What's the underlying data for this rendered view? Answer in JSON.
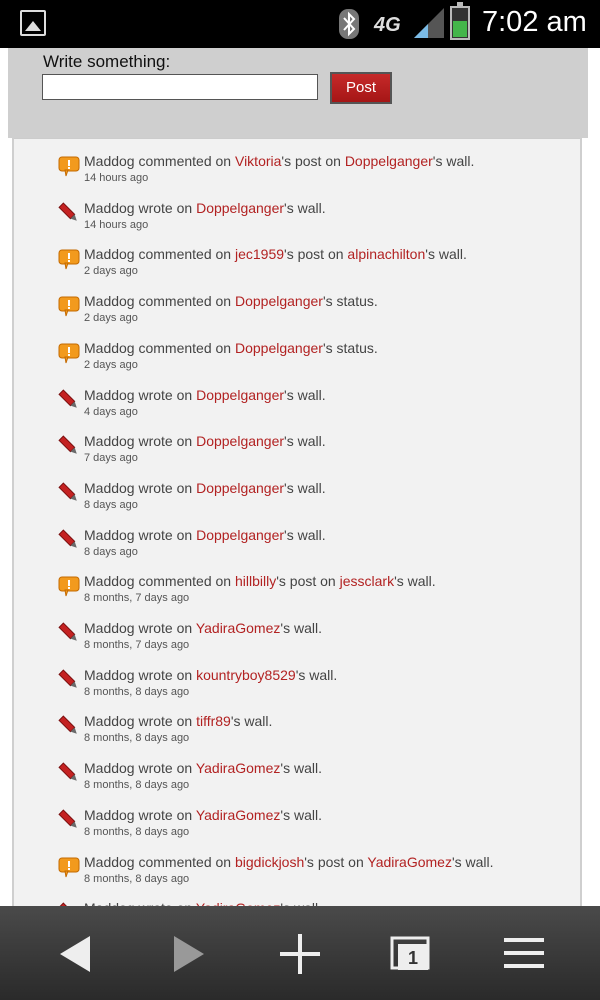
{
  "status_bar": {
    "network": "4G",
    "time": "7:02 am"
  },
  "composer": {
    "label": "Write something:",
    "input_value": "",
    "post_label": "Post"
  },
  "feed": [
    {
      "type": "comment",
      "actor": "Maddog",
      "verb": "commented on",
      "target": "Viktoria",
      "mid": "'s post on",
      "target2": "Doppelganger",
      "tail": "'s wall.",
      "time": "14 hours ago"
    },
    {
      "type": "write",
      "actor": "Maddog",
      "verb": "wrote on",
      "target": "Doppelganger",
      "mid": "",
      "target2": "",
      "tail": "'s wall.",
      "time": "14 hours ago"
    },
    {
      "type": "comment",
      "actor": "Maddog",
      "verb": "commented on",
      "target": "jec1959",
      "mid": "'s post on",
      "target2": "alpinachilton",
      "tail": "'s wall.",
      "time": "2 days ago"
    },
    {
      "type": "comment",
      "actor": "Maddog",
      "verb": "commented on",
      "target": "Doppelganger",
      "mid": "",
      "target2": "",
      "tail": "'s status.",
      "time": "2 days ago"
    },
    {
      "type": "comment",
      "actor": "Maddog",
      "verb": "commented on",
      "target": "Doppelganger",
      "mid": "",
      "target2": "",
      "tail": "'s status.",
      "time": "2 days ago"
    },
    {
      "type": "write",
      "actor": "Maddog",
      "verb": "wrote on",
      "target": "Doppelganger",
      "mid": "",
      "target2": "",
      "tail": "'s wall.",
      "time": "4 days ago"
    },
    {
      "type": "write",
      "actor": "Maddog",
      "verb": "wrote on",
      "target": "Doppelganger",
      "mid": "",
      "target2": "",
      "tail": "'s wall.",
      "time": "7 days ago"
    },
    {
      "type": "write",
      "actor": "Maddog",
      "verb": "wrote on",
      "target": "Doppelganger",
      "mid": "",
      "target2": "",
      "tail": "'s wall.",
      "time": "8 days ago"
    },
    {
      "type": "write",
      "actor": "Maddog",
      "verb": "wrote on",
      "target": "Doppelganger",
      "mid": "",
      "target2": "",
      "tail": "'s wall.",
      "time": "8 days ago"
    },
    {
      "type": "comment",
      "actor": "Maddog",
      "verb": "commented on",
      "target": "hillbilly",
      "mid": "'s post on",
      "target2": "jessclark",
      "tail": "'s wall.",
      "time": "8 months, 7 days ago"
    },
    {
      "type": "write",
      "actor": "Maddog",
      "verb": "wrote on",
      "target": "YadiraGomez",
      "mid": "",
      "target2": "",
      "tail": "'s wall.",
      "time": "8 months, 7 days ago"
    },
    {
      "type": "write",
      "actor": "Maddog",
      "verb": "wrote on",
      "target": "kountryboy8529",
      "mid": "",
      "target2": "",
      "tail": "'s wall.",
      "time": "8 months, 8 days ago"
    },
    {
      "type": "write",
      "actor": "Maddog",
      "verb": "wrote on",
      "target": "tiffr89",
      "mid": "",
      "target2": "",
      "tail": "'s wall.",
      "time": "8 months, 8 days ago"
    },
    {
      "type": "write",
      "actor": "Maddog",
      "verb": "wrote on",
      "target": "YadiraGomez",
      "mid": "",
      "target2": "",
      "tail": "'s wall.",
      "time": "8 months, 8 days ago"
    },
    {
      "type": "write",
      "actor": "Maddog",
      "verb": "wrote on",
      "target": "YadiraGomez",
      "mid": "",
      "target2": "",
      "tail": "'s wall.",
      "time": "8 months, 8 days ago"
    },
    {
      "type": "comment",
      "actor": "Maddog",
      "verb": "commented on",
      "target": "bigdickjosh",
      "mid": "'s post on",
      "target2": "YadiraGomez",
      "tail": "'s wall.",
      "time": "8 months, 8 days ago"
    },
    {
      "type": "write",
      "actor": "Maddog",
      "verb": "wrote on",
      "target": "YadiraGomez",
      "mid": "",
      "target2": "",
      "tail": "'s wall.",
      "time": ""
    }
  ],
  "icons": {
    "comment": "comment-bubble-icon",
    "write": "pencil-icon"
  },
  "colors": {
    "link": "#b22222",
    "post_button": "#b81f1f"
  }
}
